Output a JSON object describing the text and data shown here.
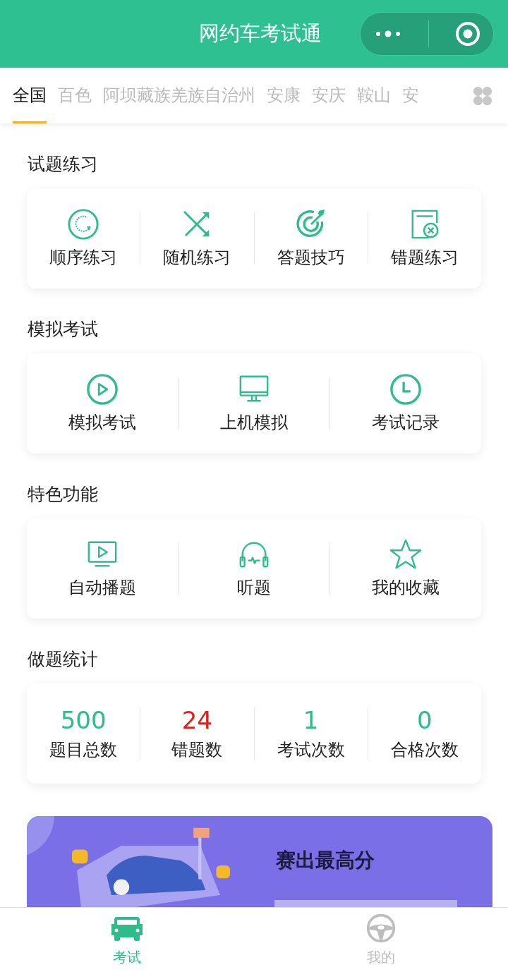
{
  "nav_bar": {
    "title": "网约车考试通"
  },
  "region_tabs": [
    {
      "label": "全国",
      "selected": true
    },
    {
      "label": "百色",
      "selected": false
    },
    {
      "label": "阿坝藏族羌族自治州",
      "selected": false
    },
    {
      "label": "安康",
      "selected": false
    },
    {
      "label": "安庆",
      "selected": false
    },
    {
      "label": "鞍山",
      "selected": false
    },
    {
      "label": "安",
      "selected": false
    }
  ],
  "sections": [
    {
      "title": "试题练习",
      "items": [
        {
          "kind": "cycle",
          "label": "顺序练习"
        },
        {
          "kind": "shuffle",
          "label": "随机练习"
        },
        {
          "kind": "target",
          "label": "答题技巧"
        },
        {
          "kind": "wrong",
          "label": "错题练习"
        }
      ]
    },
    {
      "title": "模拟考试",
      "items": [
        {
          "kind": "play",
          "label": "模拟考试"
        },
        {
          "kind": "monitor",
          "label": "上机模拟"
        },
        {
          "kind": "clock",
          "label": "考试记录"
        }
      ]
    },
    {
      "title": "特色功能",
      "items": [
        {
          "kind": "video",
          "label": "自动播题"
        },
        {
          "kind": "headphones",
          "label": "听题"
        },
        {
          "kind": "star",
          "label": "我的收藏"
        }
      ]
    }
  ],
  "stats": {
    "title": "做题统计",
    "items": [
      {
        "value": "500",
        "label": "题目总数",
        "color": "#2ebd8a"
      },
      {
        "value": "24",
        "label": "错题数",
        "color": "#e02020"
      },
      {
        "value": "1",
        "label": "考试次数",
        "color": "#2ebd8a"
      },
      {
        "value": "0",
        "label": "合格次数",
        "color": "#2ebd8a"
      }
    ]
  },
  "banner": {
    "kind": "picture",
    "headline": "赛出最高分"
  },
  "tab_bar": [
    {
      "kind": "car",
      "label": "考试",
      "selected": true
    },
    {
      "kind": "wheel",
      "label": "我的",
      "selected": false
    }
  ]
}
